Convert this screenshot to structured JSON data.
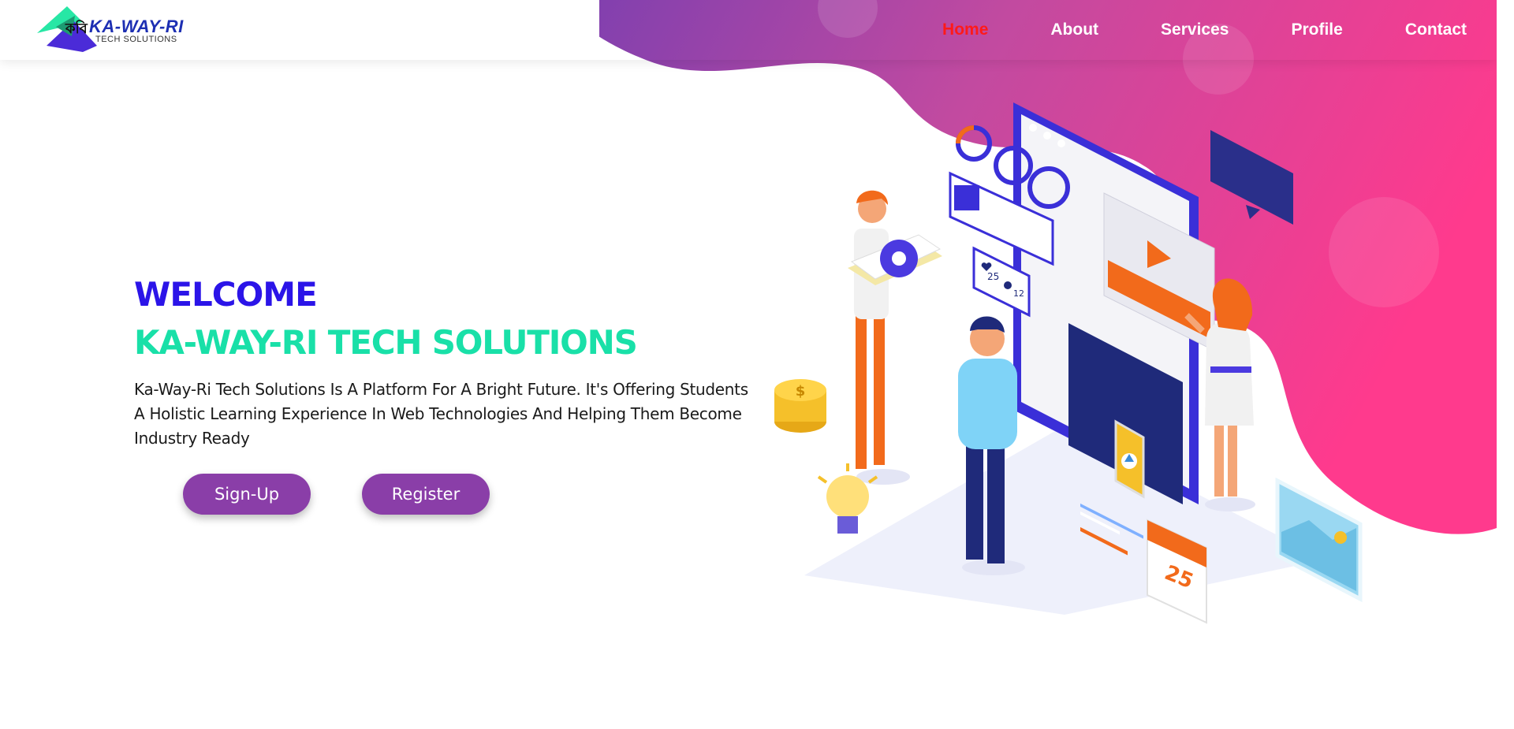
{
  "brand": {
    "name": "KA-WAY-RI",
    "tagline": "TECH SOLUTIONS",
    "glyph": "কবি"
  },
  "nav": {
    "items": [
      {
        "label": "Home",
        "active": true
      },
      {
        "label": "About",
        "active": false
      },
      {
        "label": "Services",
        "active": false
      },
      {
        "label": "Profile",
        "active": false
      },
      {
        "label": "Contact",
        "active": false
      }
    ]
  },
  "hero": {
    "welcome": "WELCOME",
    "company": "KA-WAY-RI TECH SOLUTIONS",
    "description": "Ka-Way-Ri Tech Solutions Is A Platform For A Bright Future. It's Offering Students A Holistic Learning Experience In Web Technologies And Helping Them Become Industry Ready",
    "buttons": {
      "signup": "Sign-Up",
      "register": "Register"
    }
  },
  "illustration": {
    "likes": "25",
    "comments": "12",
    "calendar_day": "25",
    "coin_symbol": "$"
  },
  "colors": {
    "welcome": "#2b14e8",
    "company": "#19e0a8",
    "button": "#8a3ea8",
    "nav_active": "#ff1a1a",
    "gradient_start": "#7b3fb0",
    "gradient_end": "#ff3a8d"
  },
  "icons": [
    "logo-icon",
    "gear-icon",
    "heart-icon",
    "comment-icon",
    "play-icon",
    "dollar-coin-icon",
    "lightbulb-icon",
    "calendar-icon",
    "image-icon",
    "chat-bubble-icon",
    "arrow-up-icon"
  ]
}
